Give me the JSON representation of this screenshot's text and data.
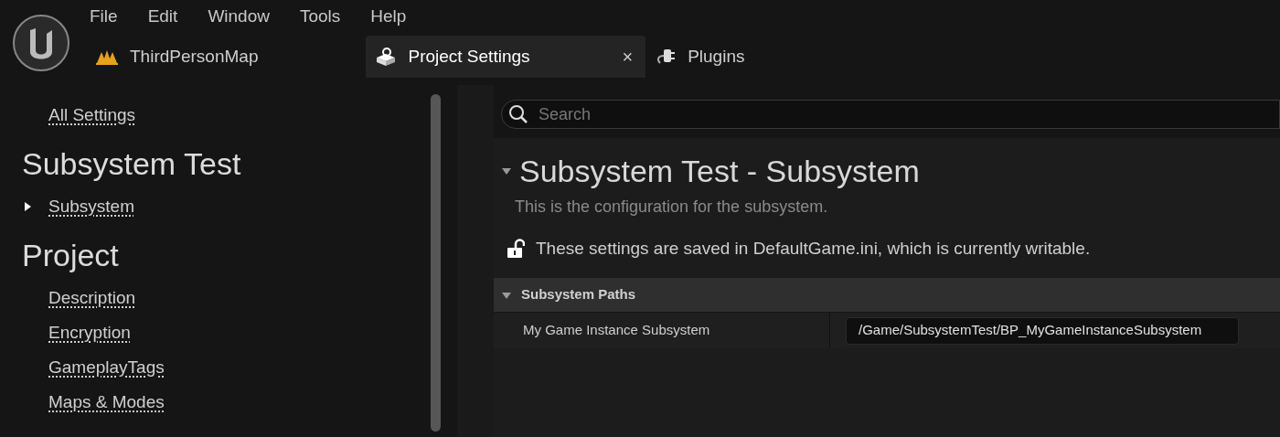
{
  "menu": [
    "File",
    "Edit",
    "Window",
    "Tools",
    "Help"
  ],
  "tabs": [
    {
      "label": "ThirdPersonMap",
      "kind": "map",
      "selected": false,
      "closable": false
    },
    {
      "label": "Project Settings",
      "kind": "settings",
      "selected": true,
      "closable": true,
      "close_glyph": "×"
    },
    {
      "label": "Plugins",
      "kind": "plugins",
      "selected": false,
      "closable": false
    }
  ],
  "sidebar": {
    "items": [
      {
        "kind": "link",
        "label": "All Settings"
      },
      {
        "kind": "heading",
        "label": "Subsystem Test"
      },
      {
        "kind": "expandable",
        "label": "Subsystem",
        "expanded": false
      },
      {
        "kind": "heading",
        "label": "Project"
      },
      {
        "kind": "link",
        "label": "Description"
      },
      {
        "kind": "link",
        "label": "Encryption"
      },
      {
        "kind": "link",
        "label": "GameplayTags"
      },
      {
        "kind": "link",
        "label": "Maps & Modes"
      }
    ]
  },
  "search": {
    "placeholder": "Search"
  },
  "section": {
    "title": "Subsystem Test - Subsystem",
    "expanded": true,
    "description": "This is the configuration for the subsystem.",
    "notice": "These settings are saved in DefaultGame.ini, which is currently writable.",
    "locked": false
  },
  "categories": [
    {
      "title": "Subsystem Paths",
      "expanded": true,
      "rows": [
        {
          "label": "My Game Instance Subsystem",
          "value": "/Game/SubsystemTest/BP_MyGameInstanceSubsystem"
        }
      ]
    }
  ]
}
